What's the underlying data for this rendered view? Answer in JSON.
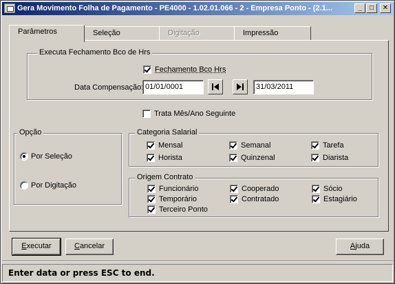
{
  "window": {
    "title": "Gera Movimento Folha de Pagamento - PE4000 - 1.02.01.066 - 2 - Empresa Ponto - (2.1...",
    "min_glyph": "_",
    "max_glyph": "□",
    "close_glyph": "✕"
  },
  "tabs": [
    {
      "label": "Parâmetros",
      "state": "active"
    },
    {
      "label": "Seleção",
      "state": "normal"
    },
    {
      "label": "Digitação",
      "state": "disabled"
    },
    {
      "label": "Impressão",
      "state": "normal"
    }
  ],
  "fechamento": {
    "group_label": "Executa Fechamento Bco de Hrs",
    "checkbox_label": "Fechamento Bco Hrs",
    "checked": true,
    "date_label": "Data Compensação:",
    "date_from": "01/01/0001",
    "date_to": "31/03/2011"
  },
  "trata": {
    "label": "Trata Mês/Ano Seguinte",
    "checked": false
  },
  "opcao": {
    "group_label": "Opção",
    "options": [
      {
        "label": "Por Seleção",
        "selected": true
      },
      {
        "label": "Por Digitação",
        "selected": false
      }
    ]
  },
  "categoria": {
    "group_label": "Categoria Salarial",
    "items": [
      {
        "label": "Mensal",
        "checked": true
      },
      {
        "label": "Semanal",
        "checked": true
      },
      {
        "label": "Tarefa",
        "checked": true
      },
      {
        "label": "Horista",
        "checked": true
      },
      {
        "label": "Quinzenal",
        "checked": true
      },
      {
        "label": "Diarista",
        "checked": true
      }
    ]
  },
  "origem": {
    "group_label": "Origem Contrato",
    "items": [
      {
        "label": "Funcionário",
        "checked": true
      },
      {
        "label": "Cooperado",
        "checked": true
      },
      {
        "label": "Sócio",
        "checked": true
      },
      {
        "label": "Temporário",
        "checked": true
      },
      {
        "label": "Contratado",
        "checked": true
      },
      {
        "label": "Estagiário",
        "checked": true
      },
      {
        "label": "Terceiro Ponto",
        "checked": true
      }
    ]
  },
  "buttons": {
    "executar_first": "E",
    "executar_rest": "xecutar",
    "cancelar_first": "C",
    "cancelar_rest": "ancelar",
    "ajuda_first": "A",
    "ajuda_rest": "juda"
  },
  "status": {
    "text": "Enter data or press ESC to end."
  }
}
